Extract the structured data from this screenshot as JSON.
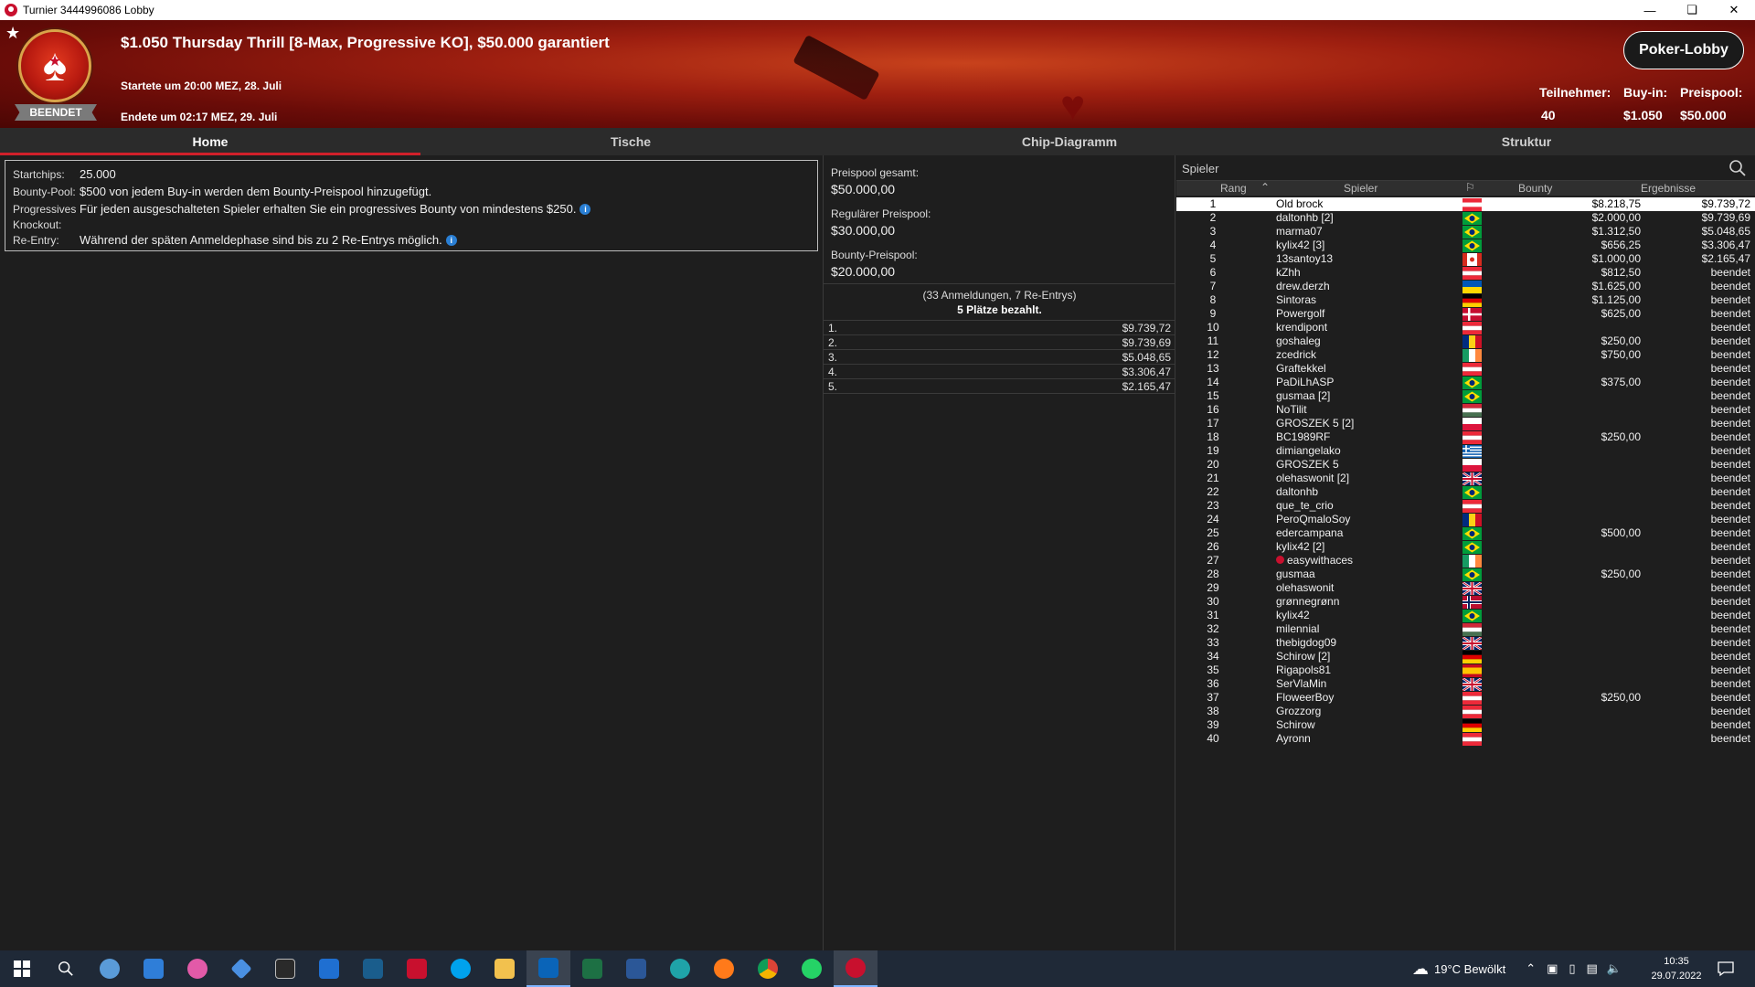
{
  "window": {
    "title": "Turnier 3444996086 Lobby"
  },
  "header": {
    "title": "$1.050 Thursday Thrill [8-Max, Progressive KO], $50.000 garantiert",
    "start": "Startete um 20:00 MEZ, 28. Juli",
    "end": "Endete um 02:17 MEZ, 29. Juli",
    "status": "BEENDET",
    "lobby_button": "Poker-Lobby",
    "stats": {
      "players_label": "Teilnehmer:",
      "players_value": "40",
      "buyin_label": "Buy-in:",
      "buyin_value": "$1.050",
      "prizepool_label": "Preispool:",
      "prizepool_value": "$50.000"
    }
  },
  "tabs": [
    "Home",
    "Tische",
    "Chip-Diagramm",
    "Struktur"
  ],
  "info": {
    "startchips_label": "Startchips:",
    "startchips_value": "25.000",
    "bounty_label": "Bounty-Pool:",
    "bounty_value": "$500 von jedem Buy-in werden dem Bounty-Preispool hinzugefügt.",
    "progressive_label": "Progressives",
    "knockout_label": "Knockout:",
    "progressive_value": "Für jeden ausgeschalteten Spieler erhalten Sie ein progressives Bounty von mindestens $250.",
    "reentry_label": "Re-Entry:",
    "reentry_value": "Während der späten Anmeldephase sind bis zu 2 Re-Entrys möglich."
  },
  "pool": {
    "total_label": "Preispool gesamt:",
    "total_value": "$50.000,00",
    "regular_label": "Regulärer Preispool:",
    "regular_value": "$30.000,00",
    "bounty_label": "Bounty-Preispool:",
    "bounty_value": "$20.000,00",
    "entries": "(33 Anmeldungen, 7 Re-Entrys)",
    "paid": "5 Plätze bezahlt.",
    "payouts": [
      {
        "place": "1.",
        "amount": "$9.739,72"
      },
      {
        "place": "2.",
        "amount": "$9.739,69"
      },
      {
        "place": "3.",
        "amount": "$5.048,65"
      },
      {
        "place": "4.",
        "amount": "$3.306,47"
      },
      {
        "place": "5.",
        "amount": "$2.165,47"
      }
    ]
  },
  "players_table": {
    "search_placeholder": "Spieler",
    "headers": {
      "rank": "Rang",
      "player": "Spieler",
      "bounty": "Bounty",
      "results": "Ergebnisse"
    },
    "rows": [
      {
        "rank": "1",
        "name": "Old brock",
        "flag": "at",
        "bounty": "$8.218,75",
        "result": "$9.739,72"
      },
      {
        "rank": "2",
        "name": "daltonhb [2]",
        "flag": "br",
        "bounty": "$2.000,00",
        "result": "$9.739,69"
      },
      {
        "rank": "3",
        "name": "marma07",
        "flag": "br",
        "bounty": "$1.312,50",
        "result": "$5.048,65"
      },
      {
        "rank": "4",
        "name": "kylix42 [3]",
        "flag": "br",
        "bounty": "$656,25",
        "result": "$3.306,47"
      },
      {
        "rank": "5",
        "name": "13santoy13",
        "flag": "ca",
        "bounty": "$1.000,00",
        "result": "$2.165,47"
      },
      {
        "rank": "6",
        "name": "kZhh",
        "flag": "at",
        "bounty": "$812,50",
        "result": "beendet"
      },
      {
        "rank": "7",
        "name": "drew.derzh",
        "flag": "ua",
        "bounty": "$1.625,00",
        "result": "beendet"
      },
      {
        "rank": "8",
        "name": "Sintoras",
        "flag": "de",
        "bounty": "$1.125,00",
        "result": "beendet"
      },
      {
        "rank": "9",
        "name": "Powergolf",
        "flag": "dk",
        "bounty": "$625,00",
        "result": "beendet"
      },
      {
        "rank": "10",
        "name": "krendipont",
        "flag": "at",
        "bounty": "",
        "result": "beendet"
      },
      {
        "rank": "11",
        "name": "goshaleg",
        "flag": "ro",
        "bounty": "$250,00",
        "result": "beendet"
      },
      {
        "rank": "12",
        "name": "zcedrick",
        "flag": "ie",
        "bounty": "$750,00",
        "result": "beendet"
      },
      {
        "rank": "13",
        "name": "Graftekkel",
        "flag": "at",
        "bounty": "",
        "result": "beendet"
      },
      {
        "rank": "14",
        "name": "PaDiLhASP",
        "flag": "br",
        "bounty": "$375,00",
        "result": "beendet"
      },
      {
        "rank": "15",
        "name": "gusmaa [2]",
        "flag": "br",
        "bounty": "",
        "result": "beendet"
      },
      {
        "rank": "16",
        "name": "NoTilit",
        "flag": "hu",
        "bounty": "",
        "result": "beendet"
      },
      {
        "rank": "17",
        "name": "GROSZEK 5 [2]",
        "flag": "pl",
        "bounty": "",
        "result": "beendet"
      },
      {
        "rank": "18",
        "name": "BC1989RF",
        "flag": "at",
        "bounty": "$250,00",
        "result": "beendet"
      },
      {
        "rank": "19",
        "name": "dimiangelako",
        "flag": "gr",
        "bounty": "",
        "result": "beendet"
      },
      {
        "rank": "20",
        "name": "GROSZEK 5",
        "flag": "pl",
        "bounty": "",
        "result": "beendet"
      },
      {
        "rank": "21",
        "name": "olehaswonit [2]",
        "flag": "gb",
        "bounty": "",
        "result": "beendet"
      },
      {
        "rank": "22",
        "name": "daltonhb",
        "flag": "br",
        "bounty": "",
        "result": "beendet"
      },
      {
        "rank": "23",
        "name": "que_te_crio",
        "flag": "at",
        "bounty": "",
        "result": "beendet"
      },
      {
        "rank": "24",
        "name": "PeroQmaloSoy",
        "flag": "ro",
        "bounty": "",
        "result": "beendet"
      },
      {
        "rank": "25",
        "name": "edercampana",
        "flag": "br",
        "bounty": "$500,00",
        "result": "beendet"
      },
      {
        "rank": "26",
        "name": "kylix42 [2]",
        "flag": "br",
        "bounty": "",
        "result": "beendet"
      },
      {
        "rank": "27",
        "name": "easywithaces",
        "flag": "ie",
        "bounty": "",
        "result": "beendet",
        "star": true
      },
      {
        "rank": "28",
        "name": "gusmaa",
        "flag": "br",
        "bounty": "$250,00",
        "result": "beendet"
      },
      {
        "rank": "29",
        "name": "olehaswonit",
        "flag": "gb",
        "bounty": "",
        "result": "beendet"
      },
      {
        "rank": "30",
        "name": "grønnegrønn",
        "flag": "no",
        "bounty": "",
        "result": "beendet"
      },
      {
        "rank": "31",
        "name": "kylix42",
        "flag": "br",
        "bounty": "",
        "result": "beendet"
      },
      {
        "rank": "32",
        "name": "milennial",
        "flag": "hu",
        "bounty": "",
        "result": "beendet"
      },
      {
        "rank": "33",
        "name": "thebigdog09",
        "flag": "gb",
        "bounty": "",
        "result": "beendet"
      },
      {
        "rank": "34",
        "name": "Schirow [2]",
        "flag": "de",
        "bounty": "",
        "result": "beendet"
      },
      {
        "rank": "35",
        "name": "Rigapols81",
        "flag": "es",
        "bounty": "",
        "result": "beendet"
      },
      {
        "rank": "36",
        "name": "SerVlaMin",
        "flag": "gb",
        "bounty": "",
        "result": "beendet"
      },
      {
        "rank": "37",
        "name": "FloweerBoy",
        "flag": "at",
        "bounty": "$250,00",
        "result": "beendet"
      },
      {
        "rank": "38",
        "name": "Grozzorg",
        "flag": "at",
        "bounty": "",
        "result": "beendet"
      },
      {
        "rank": "39",
        "name": "Schirow",
        "flag": "de",
        "bounty": "",
        "result": "beendet"
      },
      {
        "rank": "40",
        "name": "Ayronn",
        "flag": "at",
        "bounty": "",
        "result": "beendet"
      }
    ]
  },
  "taskbar": {
    "weather": "19°C  Bewölkt",
    "time": "10:35",
    "date": "29.07.2022"
  },
  "colors": {
    "accent": "#d0202a",
    "banner": "#9e1f10",
    "selected_row": "#ffffff"
  }
}
